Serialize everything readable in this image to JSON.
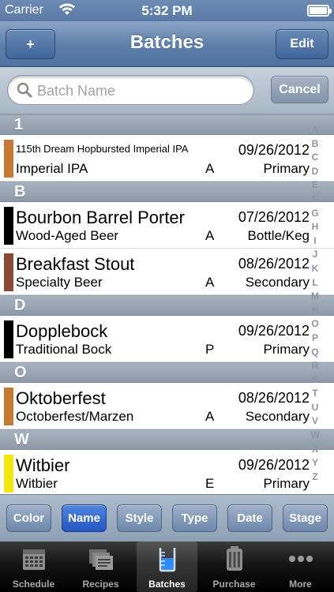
{
  "status": {
    "carrier": "Carrier",
    "time": "5:32 PM"
  },
  "nav": {
    "add_label": "+",
    "title": "Batches",
    "edit_label": "Edit"
  },
  "search": {
    "placeholder": "Batch Name",
    "value": "",
    "cancel_label": "Cancel"
  },
  "sections": [
    {
      "header": "1",
      "rows": [
        {
          "name": "115th Dream Hopbursted Imperial IPA",
          "style": "Imperial IPA",
          "date": "09/26/2012",
          "grade": "A",
          "stage": "Primary",
          "color": "#c47a35"
        }
      ]
    },
    {
      "header": "B",
      "rows": [
        {
          "name": "Bourbon Barrel Porter",
          "style": "Wood-Aged Beer",
          "date": "07/26/2012",
          "grade": "A",
          "stage": "Bottle/Keg",
          "color": "#000000"
        },
        {
          "name": "Breakfast Stout",
          "style": "Specialty Beer",
          "date": "08/26/2012",
          "grade": "A",
          "stage": "Secondary",
          "color": "#8a4a36"
        }
      ]
    },
    {
      "header": "D",
      "rows": [
        {
          "name": "Dopplebock",
          "style": "Traditional Bock",
          "date": "09/26/2012",
          "grade": "P",
          "stage": "Primary",
          "color": "#000000"
        }
      ]
    },
    {
      "header": "O",
      "rows": [
        {
          "name": "Oktoberfest",
          "style": "Octoberfest/Marzen",
          "date": "08/26/2012",
          "grade": "A",
          "stage": "Secondary",
          "color": "#c47a35"
        }
      ]
    },
    {
      "header": "W",
      "rows": [
        {
          "name": "Witbier",
          "style": "Witbier",
          "date": "09/26/2012",
          "grade": "E",
          "stage": "Primary",
          "color": "#f2e713"
        }
      ]
    }
  ],
  "index_letters": [
    "A",
    "B",
    "C",
    "D",
    "E",
    "F",
    "G",
    "H",
    "I",
    "J",
    "K",
    "L",
    "M",
    "N",
    "O",
    "P",
    "Q",
    "R",
    "S",
    "T",
    "U",
    "V",
    "W",
    "X",
    "Y",
    "Z"
  ],
  "sort_buttons": [
    {
      "label": "Color",
      "active": false
    },
    {
      "label": "Name",
      "active": true
    },
    {
      "label": "Style",
      "active": false
    },
    {
      "label": "Type",
      "active": false
    },
    {
      "label": "Date",
      "active": false
    },
    {
      "label": "Stage",
      "active": false
    }
  ],
  "tabs": [
    {
      "label": "Schedule",
      "icon": "calendar-icon",
      "selected": false
    },
    {
      "label": "Recipes",
      "icon": "recipes-icon",
      "selected": false
    },
    {
      "label": "Batches",
      "icon": "beaker-icon",
      "selected": true
    },
    {
      "label": "Purchase",
      "icon": "keg-icon",
      "selected": false
    },
    {
      "label": "More",
      "icon": "more-icon",
      "selected": false
    }
  ],
  "colors": {
    "nav_blue": "#5d7ea8",
    "active_blue": "#2f62cc"
  }
}
